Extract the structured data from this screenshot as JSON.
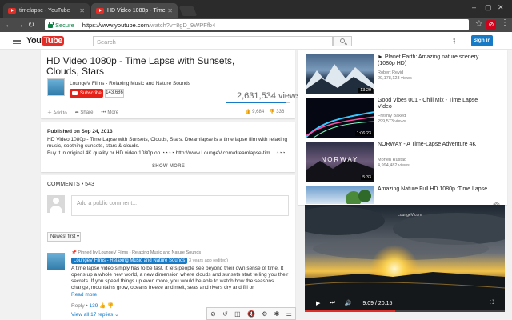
{
  "browser": {
    "tabs": [
      {
        "label": "timelapse - YouTube"
      },
      {
        "label": "HD Video 1080p - Time"
      }
    ],
    "secure_label": "Secure",
    "url_host": "https://www.youtube.com",
    "url_path": "/watch?v=8gD_9WPFfb4"
  },
  "youtube": {
    "logo_you": "You",
    "logo_tube": "Tube",
    "search_placeholder": "Search",
    "signin_label": "Sign in"
  },
  "video": {
    "title": "HD Video 1080p - Time Lapse with Sunsets, Clouds, Stars",
    "channel": "LoungeV Films - Relaxing Music and Nature Sounds",
    "subscribe_label": "Subscribe",
    "subscriber_count": "143,686",
    "views": "2,631,534 views",
    "like_ratio": 0.92,
    "actions": {
      "add_to": "Add to",
      "share": "Share",
      "more": "More"
    },
    "likes": "9,684",
    "dislikes": "336"
  },
  "description": {
    "published": "Published on Sep 24, 2013",
    "lines": [
      "HD Video 1080p - Time Lapse with Sunsets, Clouds, Stars. Dreamlapse is a time lapse film with relaxing",
      "music, soothing sunsets, stars & clouds.",
      "Buy it in original 4K quality or HD video 1080p on ◔◔◔◔ http://www.LoungeV.com/dreamlapse-tim... ◔◔◔"
    ],
    "show_more": "SHOW MORE"
  },
  "comments": {
    "header": "COMMENTS • 543",
    "input_placeholder": "Add a public comment...",
    "sort_label": "Newest first",
    "pinned_label": "Pinned by LoungeV Films - Relaxing Music and Nature Sounds",
    "author": "LoungeV Films - Relaxing Music and Nature Sounds",
    "time": "3 years ago (edited)",
    "body": "A time lapse video simply has to be fast, it lets people see beyond their own sense of time. It opens up a whole new world, a new dimension where clouds and sunsets start telling you their secrets. If you speed things up even more, you would be able to watch how the seasons change, mountains grow, oceans freeze and melt, seas and rivers dry and fill or",
    "read_more": "Read more",
    "reply_label": "Reply",
    "like_count": "139",
    "view_all": "View all 17 replies"
  },
  "sidebar": {
    "items": [
      {
        "title": "► Planet Earth: Amazing nature scenery (1080p HD)",
        "channel": "Robert Revid",
        "views": "29,178,123 views",
        "duration": "13:29"
      },
      {
        "title": "Good Vibes 001 - Chill Mix - Time Lapse Video",
        "channel": "Freshly Baked",
        "views": "299,573 views",
        "duration": "1:06:23"
      },
      {
        "title": "NORWAY - A Time-Lapse Adventure 4K",
        "channel": "Morten Rustad",
        "views": "4,994,482 views",
        "duration": "5:33",
        "overlay": "NORWAY"
      },
      {
        "title": "Amazing Nature Full HD 1080p :Time Lapse",
        "channel": "",
        "views": "",
        "duration": ""
      }
    ]
  },
  "miniplayer": {
    "time_current": "9:09",
    "time_total": "20:15",
    "progress": 0.45,
    "watermark": "LoungeV.com"
  }
}
